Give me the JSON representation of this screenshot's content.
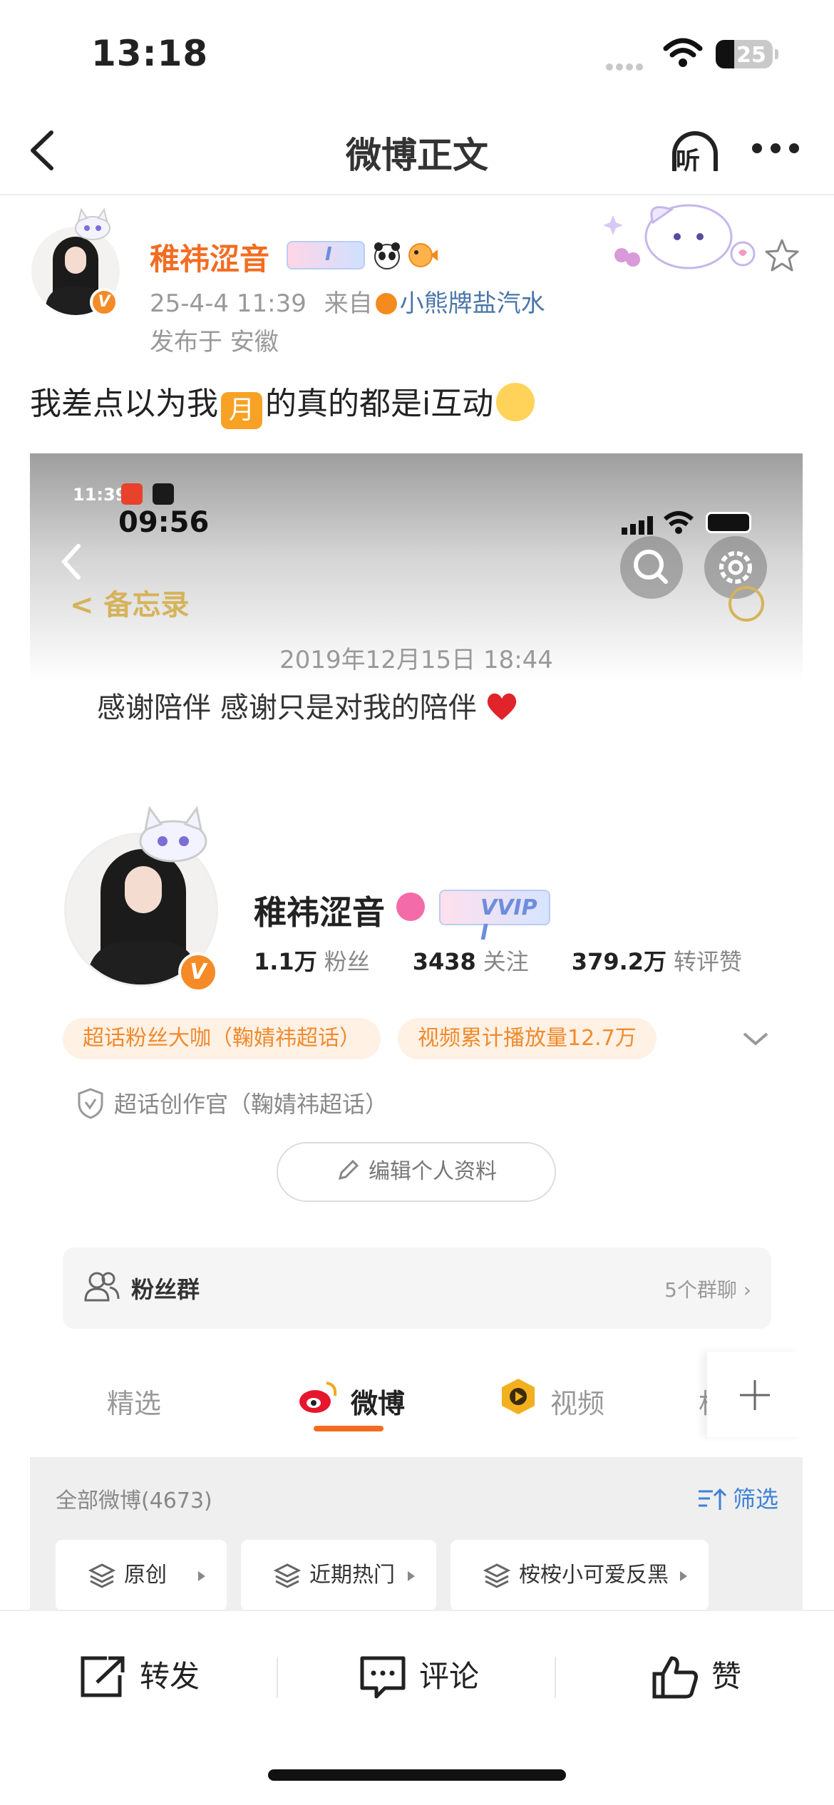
{
  "status_bar": {
    "time": "13:18",
    "battery": "25"
  },
  "nav": {
    "title": "微博正文",
    "listen_label": "听"
  },
  "post": {
    "author": "稚祎涩音",
    "datetime": "25-4-4 11:39",
    "source_prefix": "来自",
    "source": "小熊牌盐汽水",
    "location": "发布于 安徽",
    "text_before": "我差点以为我",
    "text_chip": "月",
    "text_after": "的真的都是i互动",
    "vip_label": "I"
  },
  "embedded": {
    "small_time": "11:39",
    "time": "09:56",
    "memo_back": "备忘录",
    "note_date": "2019年12月15日 18:44",
    "note_text": "感谢陪伴 感谢只是对我的陪伴",
    "profile": {
      "name": "稚祎涩音",
      "vip_label": "VVIP I",
      "fans_value": "1.1万",
      "fans_label": "粉丝",
      "follow_value": "3438",
      "follow_label": "关注",
      "likes_value": "379.2万",
      "likes_label": "转评赞",
      "tag1": "超话粉丝大咖（鞠婧祎超话）",
      "tag2": "视频累计播放量12.7万",
      "officer": "超话创作官（鞠婧祎超话）",
      "edit_button": "编辑个人资料"
    },
    "fans_group": {
      "label": "粉丝群",
      "count": "5个群聊"
    },
    "tabs": [
      "精选",
      "微博",
      "视频",
      "相"
    ],
    "all_weibo": "全部微博(4673)",
    "filter": "筛选",
    "chips": [
      "原创",
      "近期热门",
      "桉桉小可爱反黑"
    ]
  },
  "bottom_bar": {
    "repost": "转发",
    "comment": "评论",
    "like": "赞"
  },
  "colors": {
    "brand_orange": "#f36c21",
    "link_blue": "#4a76a8",
    "vip_blue": "#6e8ddc"
  },
  "icons": [
    "back-chevron-icon",
    "listen-icon",
    "more-icon",
    "star-icon",
    "repost-icon",
    "comment-icon",
    "like-icon"
  ]
}
